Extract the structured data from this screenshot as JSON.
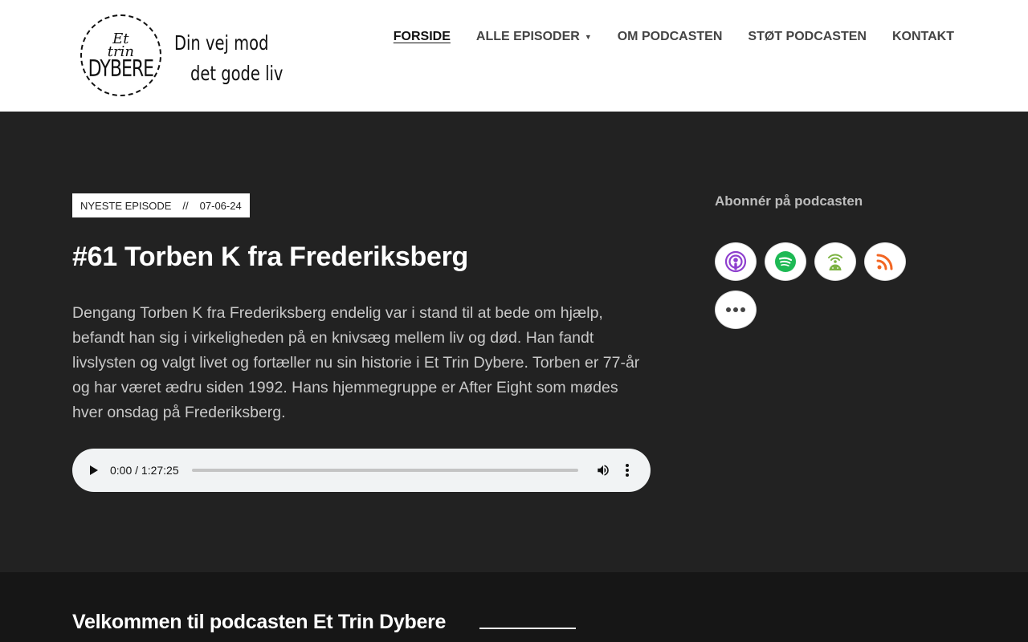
{
  "logo": {
    "line1": "Et",
    "line2": "trin",
    "line3": "DYBERE",
    "tagline_1": "Din vej mod",
    "tagline_2": "det gode liv"
  },
  "nav": {
    "items": [
      {
        "label": "FORSIDE",
        "active": true
      },
      {
        "label": "ALLE EPISODER",
        "has_dropdown": true
      },
      {
        "label": "OM PODCASTEN"
      },
      {
        "label": "STØT PODCASTEN"
      },
      {
        "label": "KONTAKT"
      }
    ]
  },
  "episode": {
    "badge_label": "NYESTE EPISODE",
    "badge_separator": "//",
    "date": "07-06-24",
    "title": "#61 Torben K fra Frederiksberg",
    "description": "Dengang Torben K fra Frederiksberg endelig var i stand til at bede om hjælp, befandt han sig i virkeligheden på en knivsæg mellem liv og død. Han fandt livslysten og valgt livet og fortæller nu sin historie i Et Trin Dybere. Torben er 77-år og har været ædru siden 1992. Hans hjemmegruppe er After Eight som mødes hver onsdag på Frederiksberg.",
    "player_time": "0:00 / 1:27:25"
  },
  "subscribe": {
    "title": "Abonnér på podcasten",
    "icons": [
      "apple-podcasts-icon",
      "spotify-icon",
      "android-podcast-icon",
      "rss-icon",
      "more-options-icon"
    ],
    "colors": {
      "apple": "#8e3fce",
      "spotify": "#1db954",
      "android": "#7cb342",
      "rss": "#f26522"
    }
  },
  "welcome": {
    "title": "Velkommen til podcasten Et Trin Dybere"
  },
  "colors": {
    "hero_bg": "#222222",
    "footer_bg": "#161616"
  }
}
